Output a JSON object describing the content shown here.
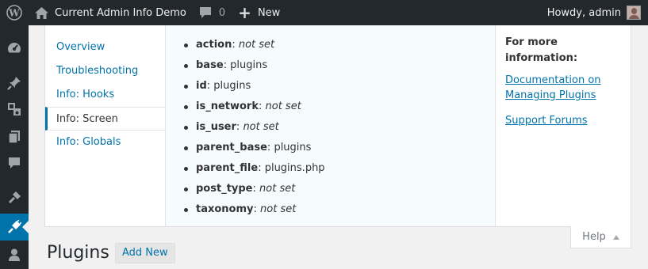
{
  "adminbar": {
    "site_name": "Current Admin Info Demo",
    "comments_count": "0",
    "new_label": "New",
    "greeting": "Howdy, admin"
  },
  "sidebar": {
    "icons": [
      "dashboard-icon",
      "pin-icon",
      "media-icon",
      "pages-icon",
      "comments-icon",
      "appearance-icon",
      "plugins-icon",
      "users-icon"
    ],
    "active": "plugins-icon",
    "accent": "#0073aa"
  },
  "help": {
    "tabs": [
      {
        "label": "Overview",
        "active": false
      },
      {
        "label": "Troubleshooting",
        "active": false
      },
      {
        "label": "Info: Hooks",
        "active": false
      },
      {
        "label": "Info: Screen",
        "active": true
      },
      {
        "label": "Info: Globals",
        "active": false
      }
    ],
    "screen_info": [
      {
        "key": "action",
        "value": "not set",
        "not_set": true
      },
      {
        "key": "base",
        "value": "plugins",
        "not_set": false
      },
      {
        "key": "id",
        "value": "plugins",
        "not_set": false
      },
      {
        "key": "is_network",
        "value": "not set",
        "not_set": true
      },
      {
        "key": "is_user",
        "value": "not set",
        "not_set": true
      },
      {
        "key": "parent_base",
        "value": "plugins",
        "not_set": false
      },
      {
        "key": "parent_file",
        "value": "plugins.php",
        "not_set": false
      },
      {
        "key": "post_type",
        "value": "not set",
        "not_set": true
      },
      {
        "key": "taxonomy",
        "value": "not set",
        "not_set": true
      }
    ],
    "sidebar_title": "For more information:",
    "links": [
      "Documentation on Managing Plugins",
      "Support Forums"
    ],
    "toggle_label": "Help"
  },
  "page": {
    "title": "Plugins",
    "add_new_label": "Add New"
  }
}
